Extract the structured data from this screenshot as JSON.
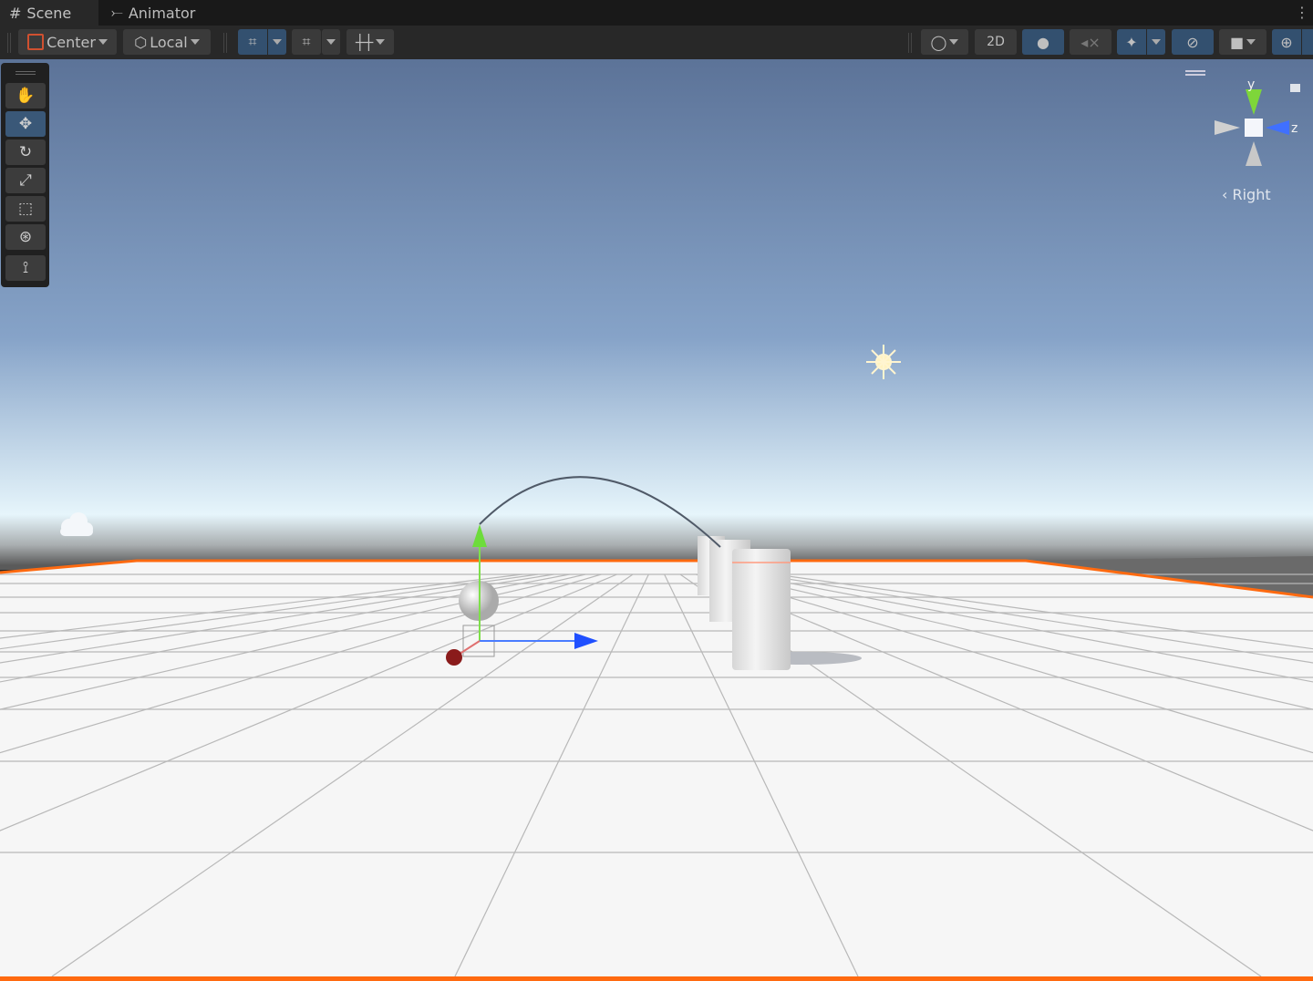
{
  "tabs": [
    {
      "label": "Scene",
      "icon": "grid-icon"
    },
    {
      "label": "Animator",
      "icon": "animator-icon"
    }
  ],
  "toolbar": {
    "pivot": "Center",
    "space": "Local",
    "mode_2d": "2D"
  },
  "tools": [
    "hand",
    "move",
    "rotate",
    "scale",
    "rect",
    "transform",
    "custom"
  ],
  "active_tool": "move",
  "gizmo": {
    "y_label": "y",
    "z_label": "z",
    "view_label": "Right"
  },
  "colors": {
    "sky_top": "#5d7498",
    "horizon": "#e8f4fa",
    "accent": "#33506f",
    "plane_outline": "#ff6a10"
  }
}
